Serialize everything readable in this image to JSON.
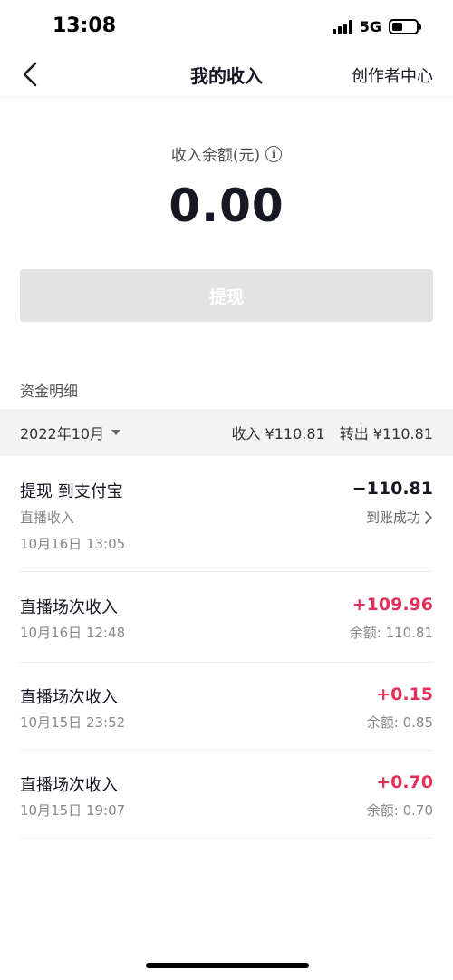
{
  "status_bar": {
    "time": "13:08",
    "network": "5G"
  },
  "nav": {
    "title": "我的收入",
    "right_link": "创作者中心",
    "back_icon": "chevron-left-icon"
  },
  "balance": {
    "label": "收入余额(元)",
    "amount": "0.00",
    "info_icon": "info-icon"
  },
  "withdraw": {
    "label": "提现"
  },
  "details": {
    "title": "资金明细",
    "month": "2022年10月",
    "income_total": "收入 ¥110.81",
    "outgoing_total": "转出 ¥110.81"
  },
  "transactions": [
    {
      "title": "提现 到支付宝",
      "subtitle": "直播收入",
      "time": "10月16日 13:05",
      "amount": "−110.81",
      "status": "到账成功"
    },
    {
      "title": "直播场次收入",
      "time": "10月16日 12:48",
      "amount": "+109.96",
      "balance": "余额: 110.81"
    },
    {
      "title": "直播场次收入",
      "time": "10月15日 23:52",
      "amount": "+0.15",
      "balance": "余额: 0.85"
    },
    {
      "title": "直播场次收入",
      "time": "10月15日 19:07",
      "amount": "+0.70",
      "balance": "余额: 0.70"
    }
  ],
  "colors": {
    "positive": "#e0325a",
    "button_disabled": "#e3e3e3",
    "filter_bg": "#f3f3f4"
  }
}
